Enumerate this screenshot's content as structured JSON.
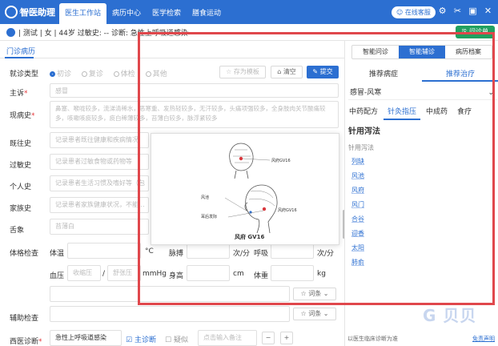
{
  "app": {
    "name": "智医助理",
    "subtitle": "SMART MEDICAL"
  },
  "nav": {
    "tabs": [
      {
        "label": "医生工作站"
      },
      {
        "label": "病历中心"
      },
      {
        "label": "医学检索"
      },
      {
        "label": "膳食运动"
      }
    ]
  },
  "service": {
    "label": "在线客服"
  },
  "patient": {
    "info": "| 测试 | 女 | 44岁  过敏史: --  诊断: 急性上呼吸道感染",
    "rx_button": "问诊单"
  },
  "left": {
    "tab": "门诊病历",
    "visit_type": {
      "label": "就诊类型",
      "options": [
        "初诊",
        "复诊",
        "体检",
        "其他"
      ]
    },
    "buttons": {
      "template": "存为模板",
      "clear": "清空",
      "submit": "提交"
    },
    "chief": {
      "label": "主诉",
      "value": "感冒"
    },
    "present": {
      "label": "现病史",
      "value": "鼻塞、喉咙较多，流涕清稀水，恶寒重、发热轻较多，无汗较多，头痛项强较多，全身肢肉关节酸痛较多，咳嗽咳痰较多，痰白稀薄较多，苔薄白较多，脉浮紧较多"
    },
    "past": {
      "label": "既往史",
      "placeholder": "记录患者既往健康和疾病情况"
    },
    "allergy": {
      "label": "过敏史",
      "placeholder": "记录患者过敏食物或药物等"
    },
    "personal": {
      "label": "个人史",
      "placeholder": "记录患者生活习惯及嗜好等（包"
    },
    "family": {
      "label": "家族史",
      "placeholder": "记录患者家族健康状况，不能..."
    },
    "tongue": {
      "label": "舌象",
      "value": "苔薄白"
    },
    "exam": {
      "label": "体格检查",
      "temp": {
        "label": "体温",
        "unit": "°C"
      },
      "pulse": {
        "label": "脉搏",
        "unit": "次/分"
      },
      "breath": {
        "label": "呼吸",
        "unit": "次/分"
      },
      "bp": {
        "label": "血压",
        "systolic": "收缩压",
        "diastolic": "舒张压",
        "unit": "mmHg"
      },
      "height": {
        "label": "身高",
        "unit": "cm"
      },
      "weight": {
        "label": "体重",
        "unit": "kg"
      }
    },
    "vocab": "词条",
    "aux": {
      "label": "辅助检查"
    },
    "diagnosis": {
      "label": "西医诊断",
      "value": "急性上呼吸道感染",
      "main": "主诊断",
      "suspect": "疑似",
      "note": "点击输入备注"
    }
  },
  "right": {
    "tabs": [
      {
        "label": "智能问诊"
      },
      {
        "label": "智能辅诊"
      },
      {
        "label": "病历档案"
      }
    ],
    "subtabs": [
      {
        "label": "推荐病症"
      },
      {
        "label": "推荐治疗"
      }
    ],
    "syndrome": "感冒-风寒",
    "treat_tabs": [
      {
        "label": "中药配方"
      },
      {
        "label": "针灸指压"
      },
      {
        "label": "中成药"
      },
      {
        "label": "食疗"
      }
    ],
    "method": "针用泻法",
    "section_label": "针用泻法",
    "points": [
      "列缺",
      "风池",
      "风府",
      "风门",
      "合谷",
      "迎香",
      "太阳",
      "肺俞"
    ],
    "footer_left": "以医生临床诊断为准",
    "footer_right": "免责声明"
  },
  "popup": {
    "labels": [
      "风府GV16",
      "风池",
      "耳后发际",
      "风府GV16"
    ],
    "caption": "风府  GV16"
  },
  "watermark": "G 贝贝"
}
